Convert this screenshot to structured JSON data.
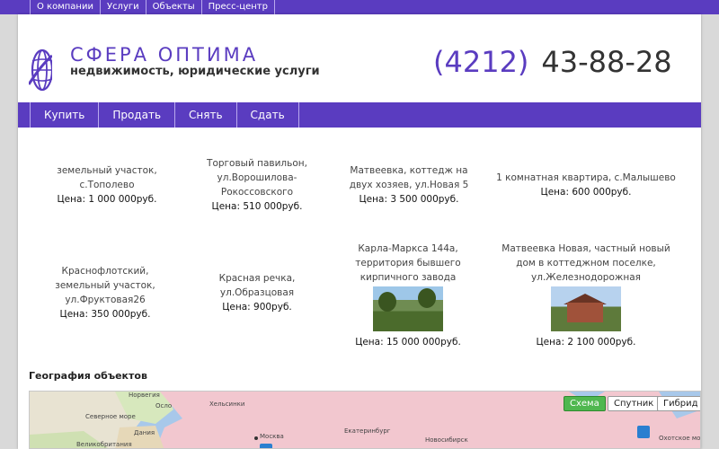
{
  "topnav": [
    "О компании",
    "Услуги",
    "Объекты",
    "Пресс-центр"
  ],
  "header": {
    "brand": "СФЕРА ОПТИМА",
    "tagline": "недвижимость, юридические услуги",
    "phone_code": "(4212)",
    "phone_number": "43-88-28"
  },
  "colors": {
    "accent": "#5a3cc0"
  },
  "mainmenu": [
    "Купить",
    "Продать",
    "Снять",
    "Сдать"
  ],
  "listings": [
    {
      "title": "земельный участок, с.Тополево",
      "price": "Цена: 1 000 000руб."
    },
    {
      "title": "Торговый павильон, ул.Ворошилова-Рокоссовского",
      "price": "Цена: 510 000руб."
    },
    {
      "title": "Матвеевка, коттедж на двух хозяев, ул.Новая 5",
      "price": "Цена: 3 500 000руб."
    },
    {
      "title": "1 комнатная квартира, с.Малышево",
      "price": "Цена: 600 000руб."
    },
    {
      "title": "Краснофлотский, земельный участок, ул.Фруктовая26",
      "price": "Цена: 350 000руб."
    },
    {
      "title": "Красная речка, ул.Образцовая",
      "price": "Цена: 900руб."
    },
    {
      "title": "Карла-Маркса 144а, территория бывшего кирпичного завода",
      "price": "Цена: 15 000 000руб.",
      "image": "field-photo"
    },
    {
      "title": "Матвеевка Новая, частный новый дом в коттеджном поселке, ул.Железнодорожная",
      "price": "Цена: 2 100 000руб.",
      "image": "house-photo"
    }
  ],
  "geo": {
    "title": "География объектов",
    "map_buttons": [
      "Схема",
      "Спутник",
      "Гибрид"
    ],
    "map_labels": [
      "Норвегия",
      "Хельсинки",
      "Осло",
      "Северное море",
      "Дания",
      "Великобритания",
      "Москва",
      "Екатеринбург",
      "Новосибирск",
      "Охотское море"
    ]
  }
}
